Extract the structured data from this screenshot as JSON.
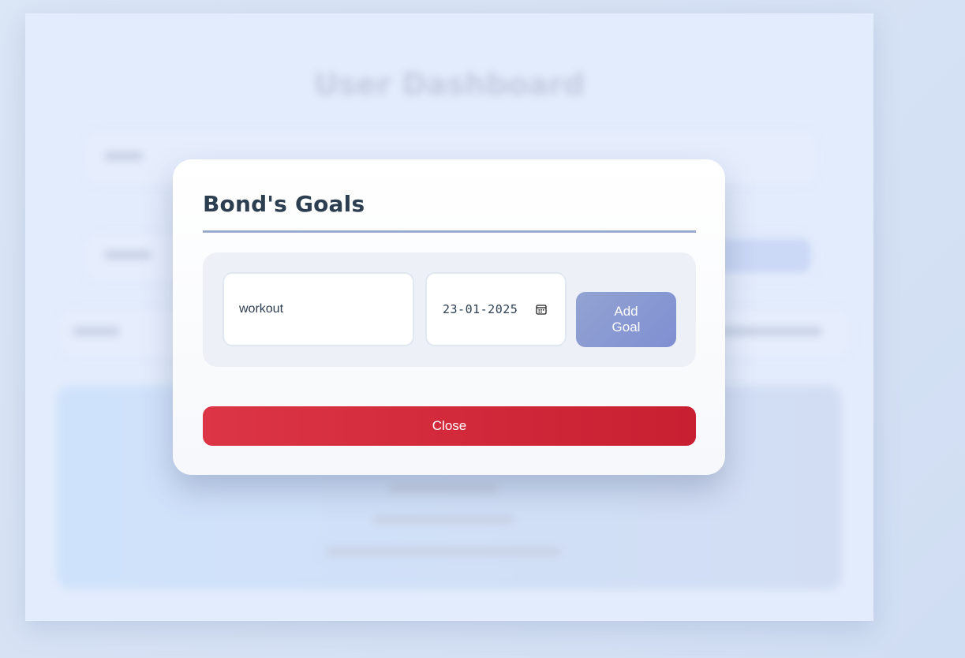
{
  "background": {
    "page_title": "User Dashboard"
  },
  "modal": {
    "title": "Bond's Goals",
    "goal_input": {
      "value": "workout"
    },
    "date_input": {
      "value": "23-01-2025",
      "icon": "calendar-icon"
    },
    "add_button_label": "Add Goal",
    "close_button_label": "Close"
  },
  "colors": {
    "accent": "#7f8fd2",
    "danger": "#dc3545",
    "heading": "#2c3e50"
  }
}
